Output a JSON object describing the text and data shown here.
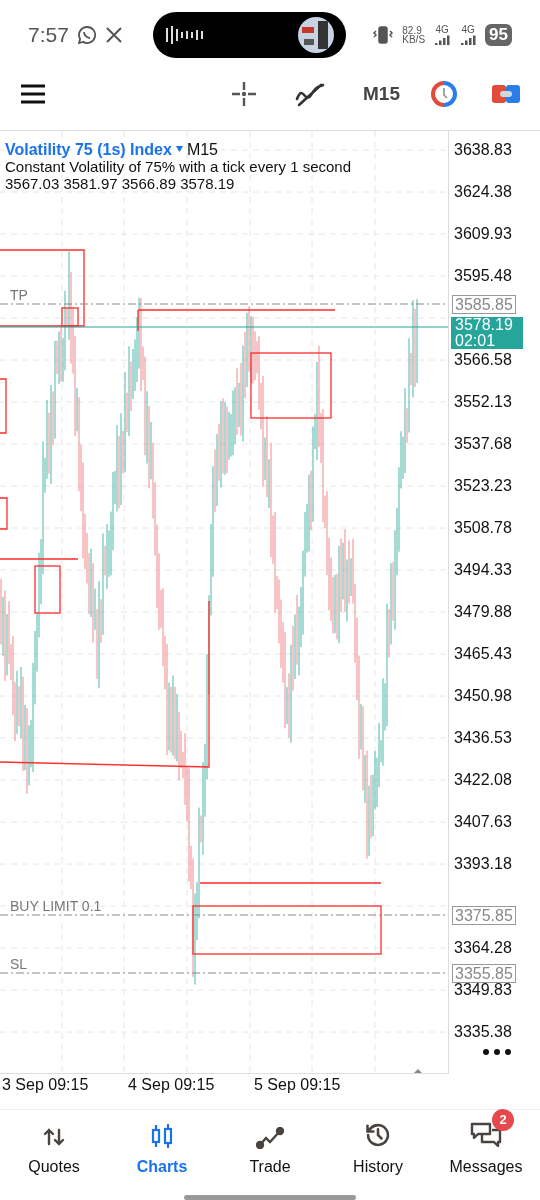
{
  "status_bar": {
    "time": "7:57",
    "net_speed": "82.9",
    "net_unit": "KB/S",
    "network_1": "4G",
    "network_2": "4G",
    "battery": "95"
  },
  "toolbar": {
    "timeframe": "M15"
  },
  "chart": {
    "symbol": "Volatility 75 (1s) Index",
    "timeframe": "M15",
    "description": "Constant Volatility of 75% with a tick every 1 second",
    "ohlc": "3567.03 3581.97 3566.89 3578.19",
    "price_ticks": [
      [
        "3638.83",
        "3624.38",
        "3609.93",
        "3595.48"
      ],
      [
        "3566.58",
        "3552.13",
        "3537.68",
        "3523.23",
        "3508.78",
        "3494.33",
        "3479.88",
        "3465.43",
        "3450.98",
        "3436.53",
        "3422.08",
        "3407.63",
        "3393.18"
      ],
      [
        "3364.28",
        "3349.83",
        "3335.38"
      ]
    ],
    "levels": [
      {
        "kind": "tp",
        "label": "TP",
        "price": "3585.85"
      },
      {
        "kind": "buy_limit",
        "label": "BUY LIMIT 0.1",
        "price": "3375.85"
      },
      {
        "kind": "sl",
        "label": "SL",
        "price": "3355.85"
      }
    ],
    "current_price": "3578.19",
    "countdown": "02:01",
    "dates": [
      "3 Sep 09:15",
      "4 Sep 09:15",
      "5 Sep 09:15"
    ]
  },
  "nav": [
    {
      "kind": "quotes",
      "label": "Quotes",
      "selected": false
    },
    {
      "kind": "charts",
      "label": "Charts",
      "selected": true
    },
    {
      "kind": "trade",
      "label": "Trade",
      "selected": false
    },
    {
      "kind": "history",
      "label": "History",
      "selected": false
    },
    {
      "kind": "messages",
      "label": "Messages",
      "selected": false,
      "badge": "2"
    }
  ]
}
